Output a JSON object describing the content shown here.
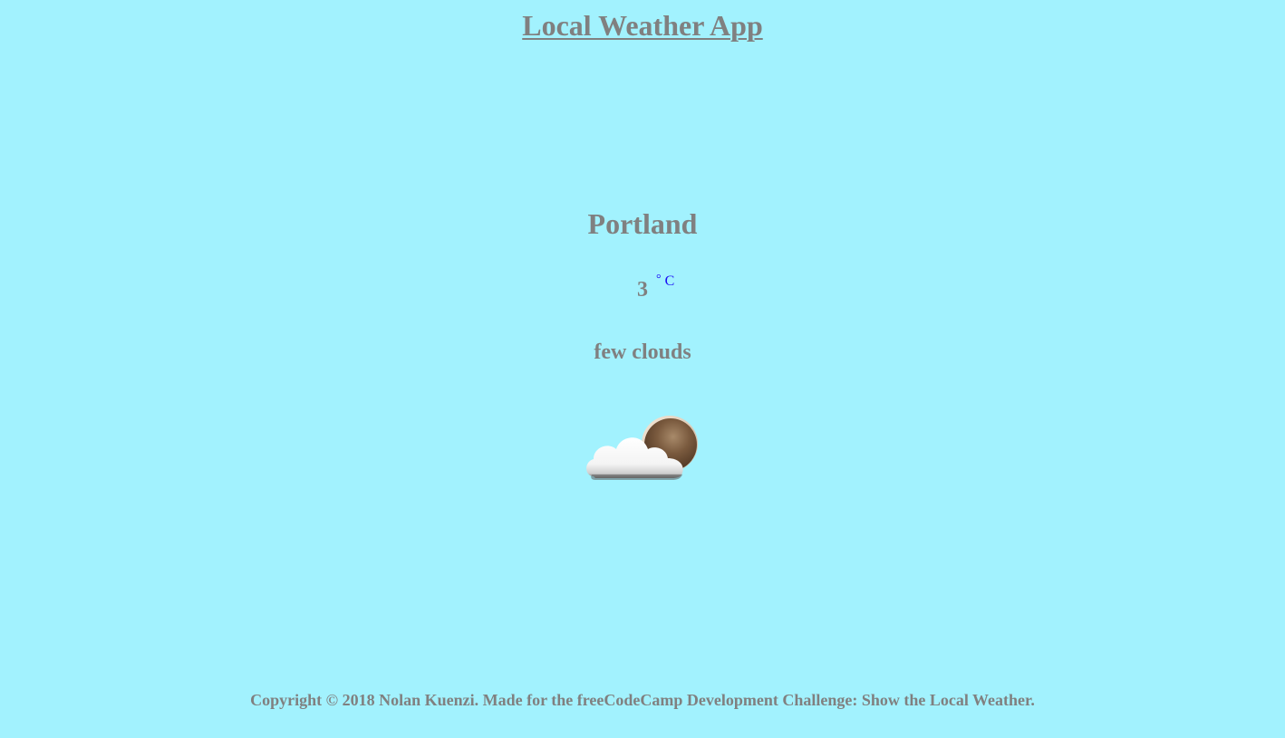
{
  "header": {
    "title": "Local Weather App"
  },
  "weather": {
    "city": "Portland",
    "temperature": "3",
    "unit_degree": "°",
    "unit_letter": "C",
    "description": "few clouds",
    "icon": "few-clouds-night-icon"
  },
  "footer": {
    "copyright": "Copyright © 2018 Nolan Kuenzi. Made for the freeCodeCamp Development Challenge: Show the Local Weather."
  },
  "colors": {
    "background": "#a2f2fe",
    "text": "#808080",
    "link": "#1a0df5"
  }
}
